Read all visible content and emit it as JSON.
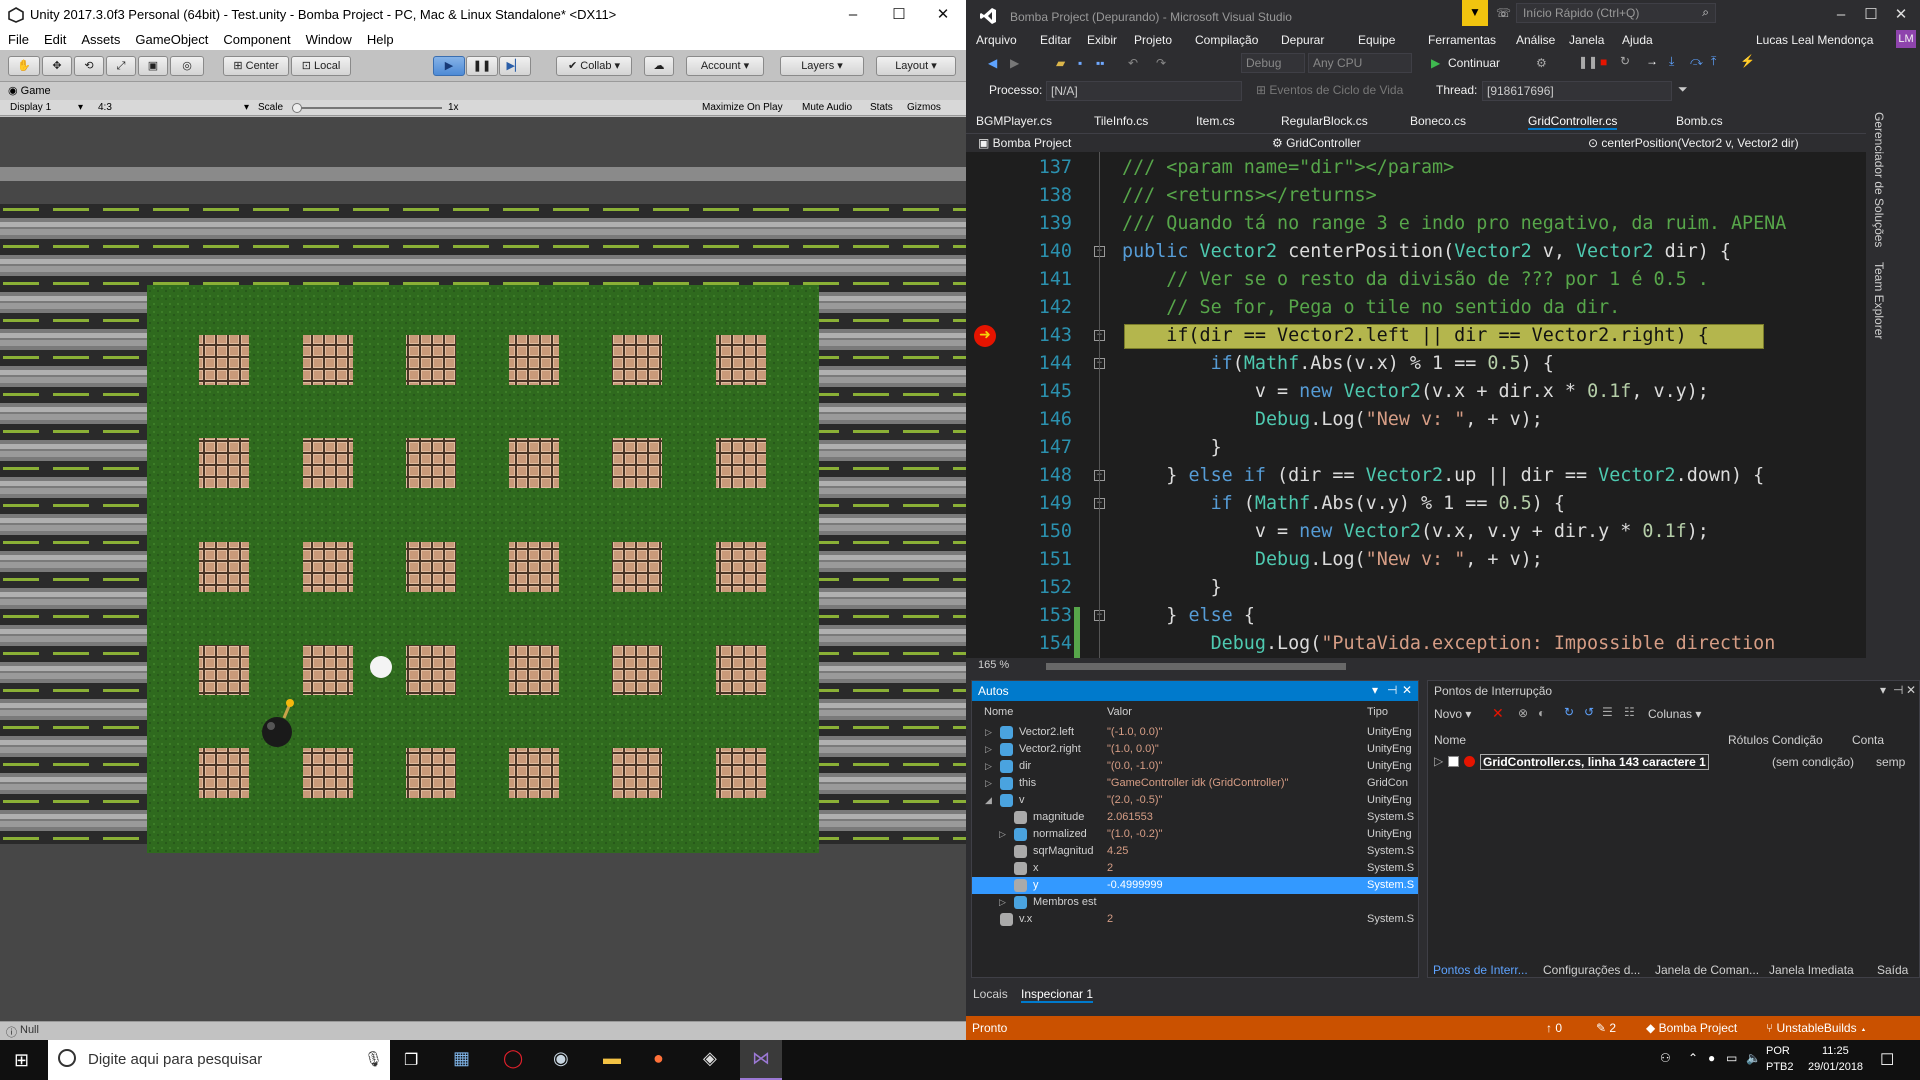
{
  "unity": {
    "title": "Unity 2017.3.0f3 Personal (64bit) - Test.unity - Bomba Project - PC, Mac & Linux Standalone* <DX11>",
    "menu": [
      "File",
      "Edit",
      "Assets",
      "GameObject",
      "Component",
      "Window",
      "Help"
    ],
    "toolbar": {
      "center": "Center",
      "local": "Local",
      "collab": "Collab",
      "account": "Account",
      "layers": "Layers",
      "layout": "Layout"
    },
    "game_tab": "Game",
    "display": "Display 1",
    "aspect": "4:3",
    "scale_label": "Scale",
    "scale_value": "1x",
    "game_options": [
      "Maximize On Play",
      "Mute Audio",
      "Stats",
      "Gizmos"
    ],
    "status": "Null"
  },
  "vs": {
    "title": "Bomba Project (Depurando) - Microsoft Visual Studio",
    "quick_launch": "Início Rápido (Ctrl+Q)",
    "user": "Lucas Leal Mendonça",
    "user_initials": "LM",
    "menu": [
      "Arquivo",
      "Editar",
      "Exibir",
      "Projeto",
      "Compilação",
      "Depurar",
      "Equipe",
      "Ferramentas",
      "Análise",
      "Janela",
      "Ajuda"
    ],
    "config": "Debug",
    "platform": "Any CPU",
    "continue": "Continuar",
    "process_label": "Processo:",
    "process_value": "[N/A]",
    "lifecycle": "Eventos de Ciclo de Vida",
    "thread_label": "Thread:",
    "thread_value": "[918617696]",
    "tabs": [
      "BGMPlayer.cs",
      "TileInfo.cs",
      "Item.cs",
      "RegularBlock.cs",
      "Boneco.cs",
      "GridController.cs",
      "Bomb.cs"
    ],
    "nav_project": "Bomba Project",
    "nav_class": "GridController",
    "nav_member": "centerPosition(Vector2 v, Vector2 dir)",
    "side_tabs": [
      "Gerenciador de Soluções",
      "Team Explorer"
    ],
    "zoom": "165 %",
    "status": "Pronto",
    "status_up": "0",
    "status_pen": "2",
    "status_project": "Bomba Project",
    "status_branch": "UnstableBuilds"
  },
  "code": [
    {
      "n": "137",
      "t": [
        [
          "cm",
          "/// <param name=\"dir\"></param>"
        ]
      ]
    },
    {
      "n": "138",
      "t": [
        [
          "cm",
          "/// <returns></returns>"
        ]
      ]
    },
    {
      "n": "139",
      "t": [
        [
          "cm",
          "/// Quando tá no range 3 e indo pro negativo, da ruim. APENA"
        ]
      ]
    },
    {
      "n": "140",
      "t": [
        [
          "kw",
          "public "
        ],
        [
          "ty",
          "Vector2 "
        ],
        [
          "",
          "centerPosition("
        ],
        [
          "ty",
          "Vector2 "
        ],
        [
          "",
          "v, "
        ],
        [
          "ty",
          "Vector2 "
        ],
        [
          "",
          "dir) {"
        ]
      ]
    },
    {
      "n": "141",
      "t": [
        [
          "cm",
          "    // Ver se o resto da divisão de ??? por 1 é 0.5 ."
        ]
      ]
    },
    {
      "n": "142",
      "t": [
        [
          "cm",
          "    // Se for, Pega o tile no sentido da dir."
        ]
      ]
    },
    {
      "n": "143",
      "t": [
        [
          "",
          "    if(dir == Vector2.left || dir == Vector2.right) {"
        ]
      ],
      "hl": true
    },
    {
      "n": "144",
      "t": [
        [
          "",
          "        "
        ],
        [
          "kw",
          "if"
        ],
        [
          "",
          "("
        ],
        [
          "ty",
          "Mathf"
        ],
        [
          "",
          ".Abs(v.x) % 1 == "
        ],
        [
          "nu",
          "0.5"
        ],
        [
          "",
          ") {"
        ]
      ]
    },
    {
      "n": "145",
      "t": [
        [
          "",
          "            v = "
        ],
        [
          "kw",
          "new "
        ],
        [
          "ty",
          "Vector2"
        ],
        [
          "",
          "(v.x + dir.x * "
        ],
        [
          "nu",
          "0.1f"
        ],
        [
          "",
          ", v.y);"
        ]
      ]
    },
    {
      "n": "146",
      "t": [
        [
          "",
          "            "
        ],
        [
          "ty",
          "Debug"
        ],
        [
          "",
          ".Log("
        ],
        [
          "st",
          "\"New v: \""
        ],
        [
          "",
          ", + v);"
        ]
      ]
    },
    {
      "n": "147",
      "t": [
        [
          "",
          "        }"
        ]
      ]
    },
    {
      "n": "148",
      "t": [
        [
          "",
          "    } "
        ],
        [
          "kw",
          "else if "
        ],
        [
          "",
          "(dir == "
        ],
        [
          "ty",
          "Vector2"
        ],
        [
          "",
          ".up || dir == "
        ],
        [
          "ty",
          "Vector2"
        ],
        [
          "",
          ".down) {"
        ]
      ]
    },
    {
      "n": "149",
      "t": [
        [
          "",
          "        "
        ],
        [
          "kw",
          "if "
        ],
        [
          "",
          "("
        ],
        [
          "ty",
          "Mathf"
        ],
        [
          "",
          ".Abs(v.y) % 1 == "
        ],
        [
          "nu",
          "0.5"
        ],
        [
          "",
          ") {"
        ]
      ]
    },
    {
      "n": "150",
      "t": [
        [
          "",
          "            v = "
        ],
        [
          "kw",
          "new "
        ],
        [
          "ty",
          "Vector2"
        ],
        [
          "",
          "(v.x, v.y + dir.y * "
        ],
        [
          "nu",
          "0.1f"
        ],
        [
          "",
          ");"
        ]
      ]
    },
    {
      "n": "151",
      "t": [
        [
          "",
          "            "
        ],
        [
          "ty",
          "Debug"
        ],
        [
          "",
          ".Log("
        ],
        [
          "st",
          "\"New v: \""
        ],
        [
          "",
          ", + v);"
        ]
      ]
    },
    {
      "n": "152",
      "t": [
        [
          "",
          "        }"
        ]
      ]
    },
    {
      "n": "153",
      "t": [
        [
          "",
          "    } "
        ],
        [
          "kw",
          "else "
        ],
        [
          "",
          "{"
        ]
      ]
    },
    {
      "n": "154",
      "t": [
        [
          "",
          "        "
        ],
        [
          "ty",
          "Debug"
        ],
        [
          "",
          ".Log("
        ],
        [
          "st",
          "\"PutaVida.exception: Impossible direction"
        ]
      ]
    }
  ],
  "autos": {
    "title": "Autos",
    "cols": [
      "Nome",
      "Valor",
      "Tipo"
    ],
    "rows": [
      {
        "tw": "▷",
        "name": "Vector2.left",
        "value": "\"(-1.0, 0.0)\"",
        "type": "UnityEng"
      },
      {
        "tw": "▷",
        "name": "Vector2.right",
        "value": "\"(1.0, 0.0)\"",
        "type": "UnityEng"
      },
      {
        "tw": "▷",
        "name": "dir",
        "value": "\"(0.0, -1.0)\"",
        "type": "UnityEng"
      },
      {
        "tw": "▷",
        "name": "this",
        "value": "\"GameController idk (GridController)\"",
        "type": "GridCon"
      },
      {
        "tw": "◢",
        "name": "v",
        "value": "\"(2.0, -0.5)\"",
        "type": "UnityEng"
      },
      {
        "tw": "",
        "name": "magnitude",
        "value": "2.061553",
        "type": "System.S",
        "ind": 1
      },
      {
        "tw": "▷",
        "name": "normalized",
        "value": "\"(1.0, -0.2)\"",
        "type": "UnityEng",
        "ind": 1
      },
      {
        "tw": "",
        "name": "sqrMagnitud",
        "value": "4.25",
        "type": "System.S",
        "ind": 1
      },
      {
        "tw": "",
        "name": "x",
        "value": "2",
        "type": "System.S",
        "ind": 1
      },
      {
        "tw": "",
        "name": "y",
        "value": "-0.4999999",
        "type": "System.S",
        "ind": 1,
        "sel": true
      },
      {
        "tw": "▷",
        "name": "Membros est",
        "value": "",
        "type": "",
        "ind": 1
      },
      {
        "tw": "",
        "name": "v.x",
        "value": "2",
        "type": "System.S"
      }
    ],
    "tabs": [
      "Locais",
      "Inspecionar 1"
    ]
  },
  "breakpoints": {
    "title": "Pontos de Interrupção",
    "new_label": "Novo",
    "columns_label": "Colunas",
    "cols": [
      "Nome",
      "Rótulos",
      "Condição",
      "Conta"
    ],
    "row": {
      "name": "GridController.cs, linha 143 caractere 1",
      "cond": "(sem condição)",
      "count": "semp"
    },
    "tabs": [
      "Pontos de Interr...",
      "Configurações d...",
      "Janela de Coman...",
      "Janela Imediata",
      "Saída"
    ]
  },
  "taskbar": {
    "search": "Digite aqui para pesquisar",
    "lang1": "POR",
    "lang2": "PTB2",
    "time": "11:25",
    "date": "29/01/2018"
  }
}
